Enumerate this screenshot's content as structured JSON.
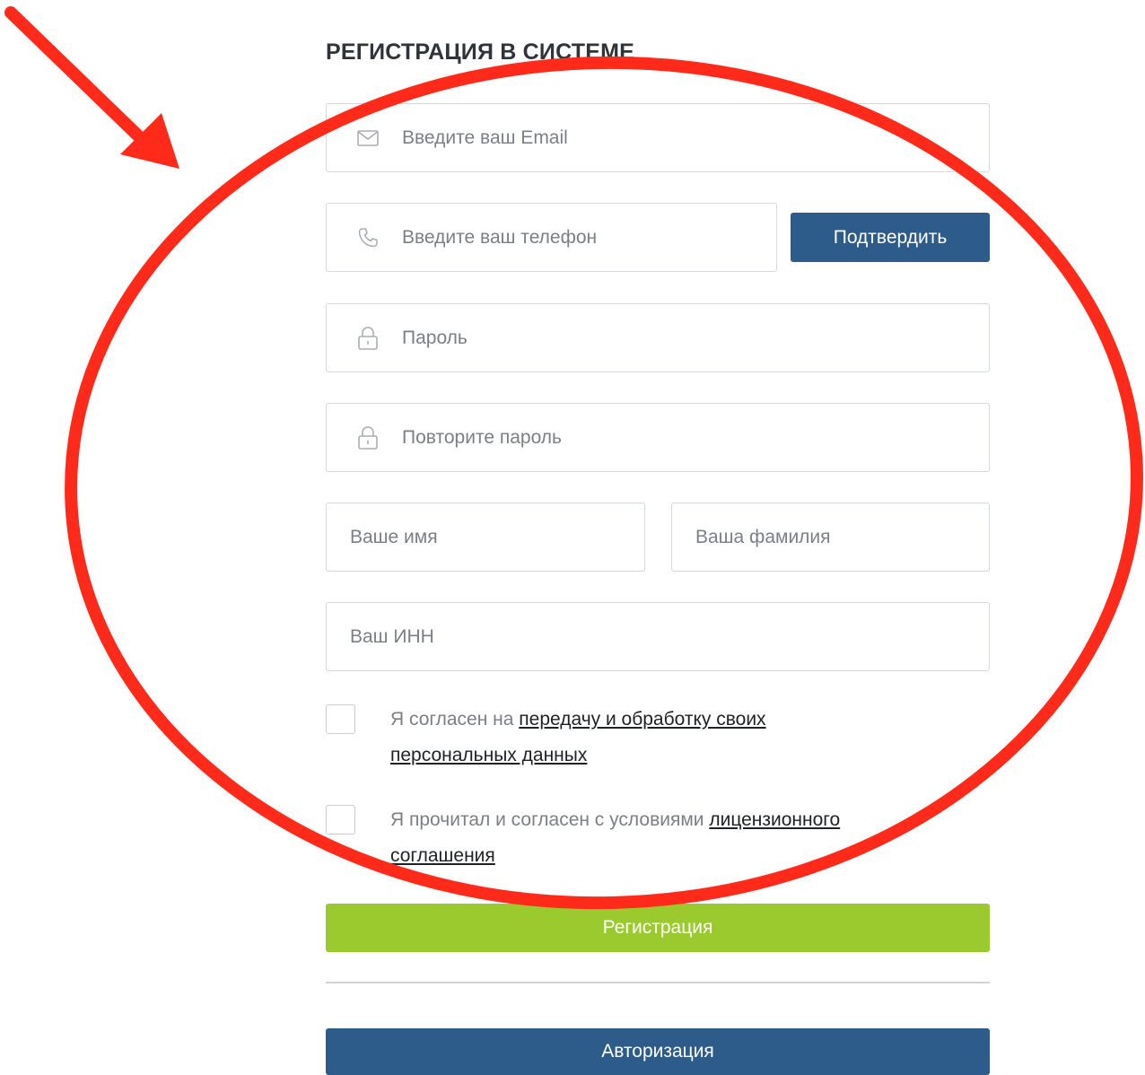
{
  "form": {
    "title": "РЕГИСТРАЦИЯ В СИСТЕМЕ",
    "email": {
      "placeholder": "Введите ваш Email",
      "icon": "envelope-icon"
    },
    "phone": {
      "placeholder": "Введите ваш телефон",
      "icon": "phone-icon"
    },
    "confirm_button": "Подтвердить",
    "password": {
      "placeholder": "Пароль",
      "icon": "lock-icon"
    },
    "password_repeat": {
      "placeholder": "Повторите пароль",
      "icon": "lock-icon"
    },
    "first_name": {
      "placeholder": "Ваше имя"
    },
    "last_name": {
      "placeholder": "Ваша фамилия"
    },
    "inn": {
      "placeholder": "Ваш ИНН"
    },
    "agree_personal": {
      "prefix": "Я согласен на ",
      "link": "передачу и обработку своих персональных данных"
    },
    "agree_license": {
      "prefix": "Я прочитал и согласен с условиями ",
      "link": "лицензионного соглашения"
    },
    "register_button": "Регистрация",
    "login_button": "Авторизация"
  },
  "colors": {
    "primary_blue": "#2d5c8a",
    "register_green": "#9aca2e",
    "annotation_red": "#ff2a1a"
  }
}
